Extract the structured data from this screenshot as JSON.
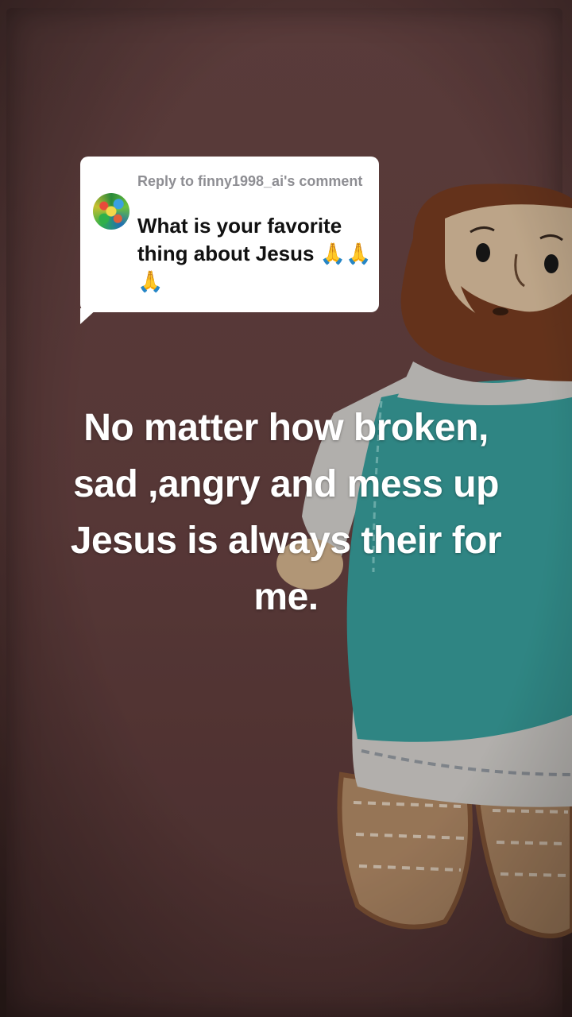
{
  "reply": {
    "header": "Reply to finny1998_ai's comment",
    "text": "What is your favorite thing about Jesus 🙏🙏🙏"
  },
  "caption": {
    "text": "No matter how broken, sad ,angry and mess up Jesus is always their for me."
  },
  "colors": {
    "bubble_bg": "#ffffff",
    "bubble_header": "#8e8e93",
    "bubble_text": "#111111",
    "caption_text": "#ffffff",
    "background": "#6a4544",
    "tunic_teal": "#3aa3a0"
  }
}
